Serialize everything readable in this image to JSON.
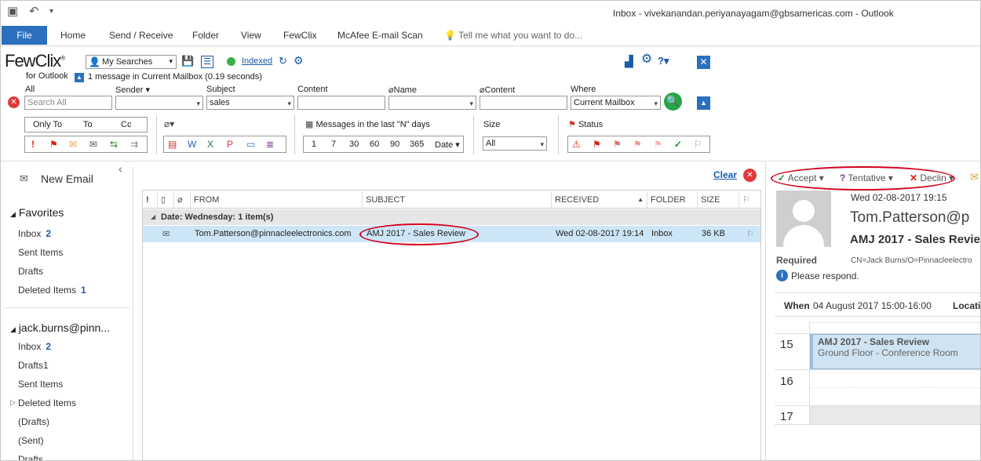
{
  "window": {
    "title": "Inbox - vivekanandan.periyanayagam@gbsamericas.com - Outlook"
  },
  "ribbon": {
    "file": "File",
    "tabs": [
      "Home",
      "Send / Receive",
      "Folder",
      "View",
      "FewClix",
      "McAfee E-mail Scan"
    ],
    "tell_me": "Tell me what you want to do..."
  },
  "fewclix": {
    "logo": "FewClix",
    "logo_sub": "for Outlook",
    "my_searches": "My Searches",
    "indexed": "Indexed",
    "status": "1 message in Current Mailbox (0.19 seconds)",
    "labels": {
      "all": "All",
      "sender": "Sender",
      "subject": "Subject",
      "content": "Content",
      "att_name": "Name",
      "att_content": "Content",
      "where": "Where"
    },
    "search_all_placeholder": "Search All",
    "subject_value": "sales",
    "where_value": "Current Mailbox",
    "only_to": "Only To",
    "to": "To",
    "cc": "Cc",
    "last_n_label": "Messages in the last \"N\" days",
    "days": [
      "1",
      "7",
      "30",
      "60",
      "90",
      "365"
    ],
    "date_label": "Date",
    "size_label": "Size",
    "size_value": "All",
    "status_label": "Status"
  },
  "nav": {
    "new_email": "New Email",
    "favorites": "Favorites",
    "fav_items": [
      {
        "label": "Inbox",
        "count": "2"
      },
      {
        "label": "Sent Items",
        "count": ""
      },
      {
        "label": "Drafts",
        "count": ""
      },
      {
        "label": "Deleted Items",
        "count": "1"
      }
    ],
    "account": "jack.burns@pinn...",
    "acct_items": [
      {
        "label": "Inbox",
        "count": "2"
      },
      {
        "label": "Drafts1",
        "count": ""
      },
      {
        "label": "Sent Items",
        "count": ""
      },
      {
        "label": "Deleted Items",
        "count": ""
      },
      {
        "label": "(Drafts)",
        "count": ""
      },
      {
        "label": "(Sent)",
        "count": ""
      },
      {
        "label": "Drafts",
        "count": ""
      }
    ]
  },
  "list": {
    "clear": "Clear",
    "columns": {
      "from": "FROM",
      "subject": "SUBJECT",
      "received": "RECEIVED",
      "folder": "FOLDER",
      "size": "SIZE"
    },
    "group": "Date: Wednesday: 1 item(s)",
    "row": {
      "from": "Tom.Patterson@pinnacleelectronics.com",
      "subject": "AMJ 2017 - Sales Review",
      "received": "Wed 02-08-2017 19:14",
      "folder": "Inbox",
      "size": "36 KB"
    }
  },
  "reading": {
    "accept": "Accept",
    "tentative": "Tentative",
    "decline": "Declin",
    "date": "Wed 02-08-2017 19:15",
    "sender": "Tom.Patterson@p",
    "subject": "AMJ 2017 - Sales Review",
    "required_label": "Required",
    "required_value": "CN=Jack Burns/O=Pinnacleelectro",
    "respond": "Please respond.",
    "when_label": "When",
    "when_value": "04 August 2017 15:00-16:00",
    "location_label": "Locatio",
    "hours": [
      "15",
      "16",
      "17"
    ],
    "event_title": "AMJ 2017 - Sales Review",
    "event_location": "Ground Floor - Conference Room"
  },
  "colors": {
    "accent": "#2b6fbe",
    "selected_row": "#cde6f7",
    "annotation": "#d0021b",
    "event": "#cfe3f2"
  }
}
